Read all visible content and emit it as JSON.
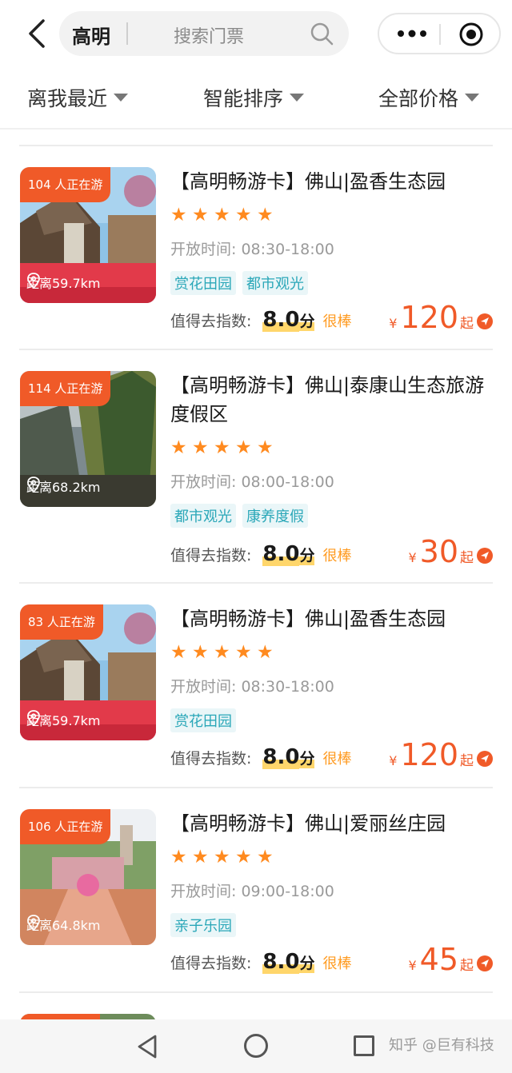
{
  "header": {
    "city": "高明",
    "search_placeholder": "搜索门票"
  },
  "filters": [
    {
      "label": "离我最近"
    },
    {
      "label": "智能排序"
    },
    {
      "label": "全部价格"
    }
  ],
  "listings": [
    {
      "visitors": "104 人正在游",
      "distance": "距离59.7km",
      "title": "【高明畅游卡】佛山|盈香生态园",
      "rating": 5,
      "hours": "开放时间: 08:30-18:00",
      "tags": [
        "赏花田园",
        "都市观光"
      ],
      "score_label": "值得去指数:",
      "score_value": "8.0",
      "score_unit": "分",
      "score_text": "很棒",
      "currency": "¥",
      "price": "120",
      "price_suffix": "起"
    },
    {
      "visitors": "114 人正在游",
      "distance": "距离68.2km",
      "title": "【高明畅游卡】佛山|泰康山生态旅游度假区",
      "rating": 5,
      "hours": "开放时间: 08:00-18:00",
      "tags": [
        "都市观光",
        "康养度假"
      ],
      "score_label": "值得去指数:",
      "score_value": "8.0",
      "score_unit": "分",
      "score_text": "很棒",
      "currency": "¥",
      "price": "30",
      "price_suffix": "起"
    },
    {
      "visitors": "83 人正在游",
      "distance": "距离59.7km",
      "title": "【高明畅游卡】佛山|盈香生态园",
      "rating": 5,
      "hours": "开放时间: 08:30-18:00",
      "tags": [
        "赏花田园"
      ],
      "score_label": "值得去指数:",
      "score_value": "8.0",
      "score_unit": "分",
      "score_text": "很棒",
      "currency": "¥",
      "price": "120",
      "price_suffix": "起"
    },
    {
      "visitors": "106 人正在游",
      "distance": "距离64.8km",
      "title": "【高明畅游卡】佛山|爱丽丝庄园",
      "rating": 5,
      "hours": "开放时间: 09:00-18:00",
      "tags": [
        "亲子乐园"
      ],
      "score_label": "值得去指数:",
      "score_value": "8.0",
      "score_unit": "分",
      "score_text": "很棒",
      "currency": "¥",
      "price": "45",
      "price_suffix": "起"
    }
  ],
  "watermark": "知乎 @巨有科技",
  "colors": {
    "accent": "#f05a28",
    "star": "#ff8a1f",
    "tag": "#2aa7b8",
    "highlight": "#ffd66b"
  }
}
